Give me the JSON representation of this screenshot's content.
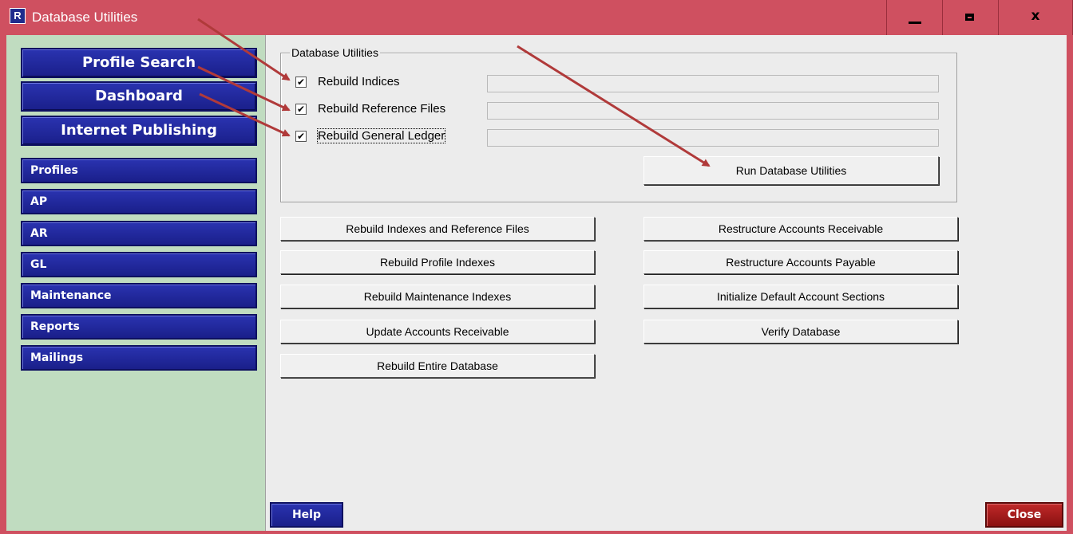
{
  "window": {
    "title": "Database Utilities",
    "icon_letter": "R",
    "minimize_glyph": "minimize-icon",
    "maximize_glyph": "maximize-icon",
    "close_glyph": "x"
  },
  "sidebar": {
    "big_buttons": [
      "Profile Search",
      "Dashboard",
      "Internet Publishing"
    ],
    "nav_items": [
      "Profiles",
      "AP",
      "AR",
      "GL",
      "Maintenance",
      "Reports",
      "Mailings"
    ]
  },
  "utilities": {
    "group_title": "Database Utilities",
    "checkboxes": [
      {
        "label": "Rebuild Indices",
        "checked": true
      },
      {
        "label": "Rebuild Reference Files",
        "checked": true
      },
      {
        "label": "Rebuild General Ledger",
        "checked": true
      }
    ],
    "check_glyph": "✔",
    "run_button": "Run Database Utilities"
  },
  "left_buttons": [
    "Rebuild Indexes and Reference Files",
    "Rebuild Profile Indexes",
    "Rebuild Maintenance Indexes",
    "Update Accounts Receivable",
    "Rebuild Entire Database"
  ],
  "right_buttons": [
    "Restructure Accounts Receivable",
    "Restructure Accounts Payable",
    "Initialize Default Account Sections",
    "Verify Database"
  ],
  "footer": {
    "help": "Help",
    "close": "Close"
  },
  "colors": {
    "title_bar": "#cf5060",
    "nav_button": "#1f2c8c",
    "sidebar": "#c0dcc0",
    "close_button": "#a81c1c",
    "annotation_arrow": "#b03a3a"
  }
}
